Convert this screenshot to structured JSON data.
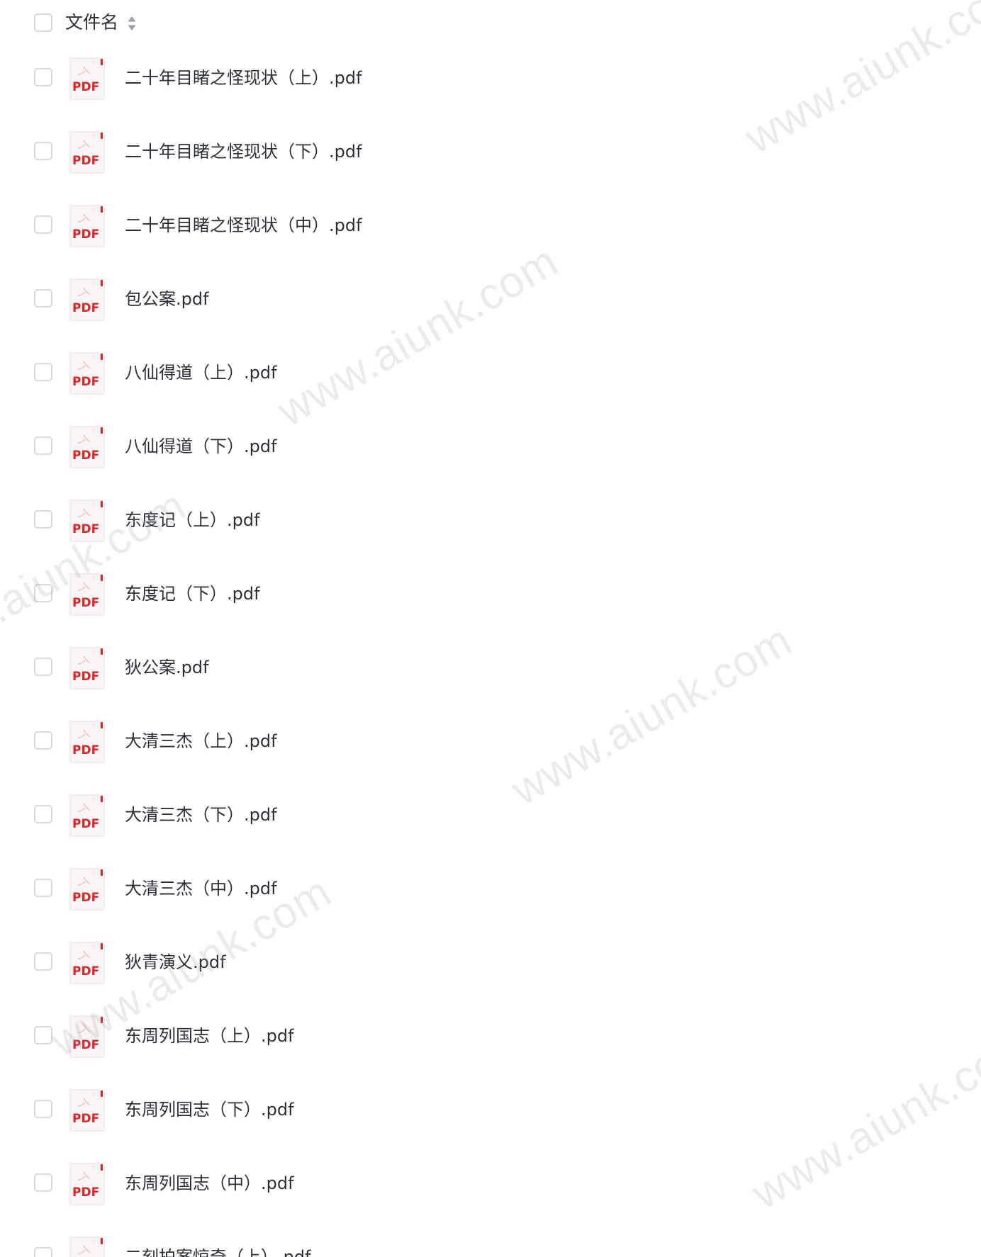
{
  "header": {
    "column_label": "文件名",
    "sort_icon": "sort-up-down-icon"
  },
  "file_icon": {
    "name": "pdf-file-icon",
    "label": "PDF",
    "accent_color": "#d9262b"
  },
  "files": [
    {
      "name": "二十年目睹之怪现状（上）.pdf"
    },
    {
      "name": "二十年目睹之怪现状（下）.pdf"
    },
    {
      "name": "二十年目睹之怪现状（中）.pdf"
    },
    {
      "name": "包公案.pdf"
    },
    {
      "name": "八仙得道（上）.pdf"
    },
    {
      "name": "八仙得道（下）.pdf"
    },
    {
      "name": "东度记（上）.pdf"
    },
    {
      "name": "东度记（下）.pdf"
    },
    {
      "name": "狄公案.pdf"
    },
    {
      "name": "大清三杰（上）.pdf"
    },
    {
      "name": "大清三杰（下）.pdf"
    },
    {
      "name": "大清三杰（中）.pdf"
    },
    {
      "name": "狄青演义.pdf"
    },
    {
      "name": "东周列国志（上）.pdf"
    },
    {
      "name": "东周列国志（下）.pdf"
    },
    {
      "name": "东周列国志（中）.pdf"
    },
    {
      "name": "二刻拍案惊奇（上）.pdf"
    }
  ],
  "watermark": {
    "text": "www.aiunk.com",
    "color": "#a0a4aa"
  }
}
